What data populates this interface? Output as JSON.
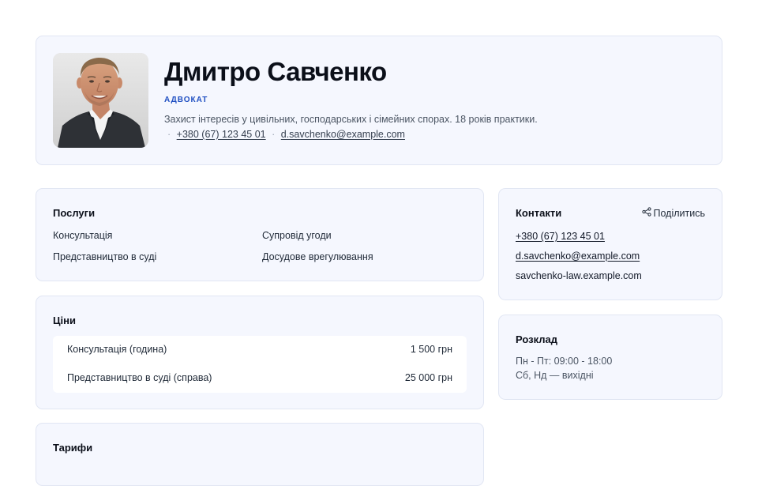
{
  "profile": {
    "name": "Дмитро Савченко",
    "role": "АДВОКАТ",
    "bio": "Захист інтересів у цивільних, господарських і сімейних спорах. 18 років практики.",
    "separator": "·",
    "phone": "+380 (67) 123 45 01",
    "email": "d.savchenko@example.com"
  },
  "services": {
    "title": "Послуги",
    "items": [
      "Консультація",
      "Супровід угоди",
      "Представництво в суді",
      "Досудове врегулювання"
    ]
  },
  "prices": {
    "title": "Ціни",
    "rows": [
      {
        "name": "Консультація (година)",
        "price": "1 500 грн"
      },
      {
        "name": "Представництво в суді (справа)",
        "price": "25 000 грн"
      }
    ]
  },
  "tariffs": {
    "title": "Тарифи"
  },
  "contacts": {
    "title": "Контакти",
    "share_label": "Поділитись",
    "phone": "+380 (67) 123 45 01",
    "email": "d.savchenko@example.com",
    "website": "savchenko-law.example.com"
  },
  "schedule": {
    "title": "Розклад",
    "lines": [
      "Пн - Пт: 09:00 - 18:00",
      "Сб, Нд — вихідні"
    ]
  },
  "icons": {
    "share": "share-icon",
    "avatar": "profile-photo"
  },
  "colors": {
    "accent": "#1f4fc2",
    "card_bg": "#f5f7fe",
    "card_border": "#e1e6f3"
  }
}
